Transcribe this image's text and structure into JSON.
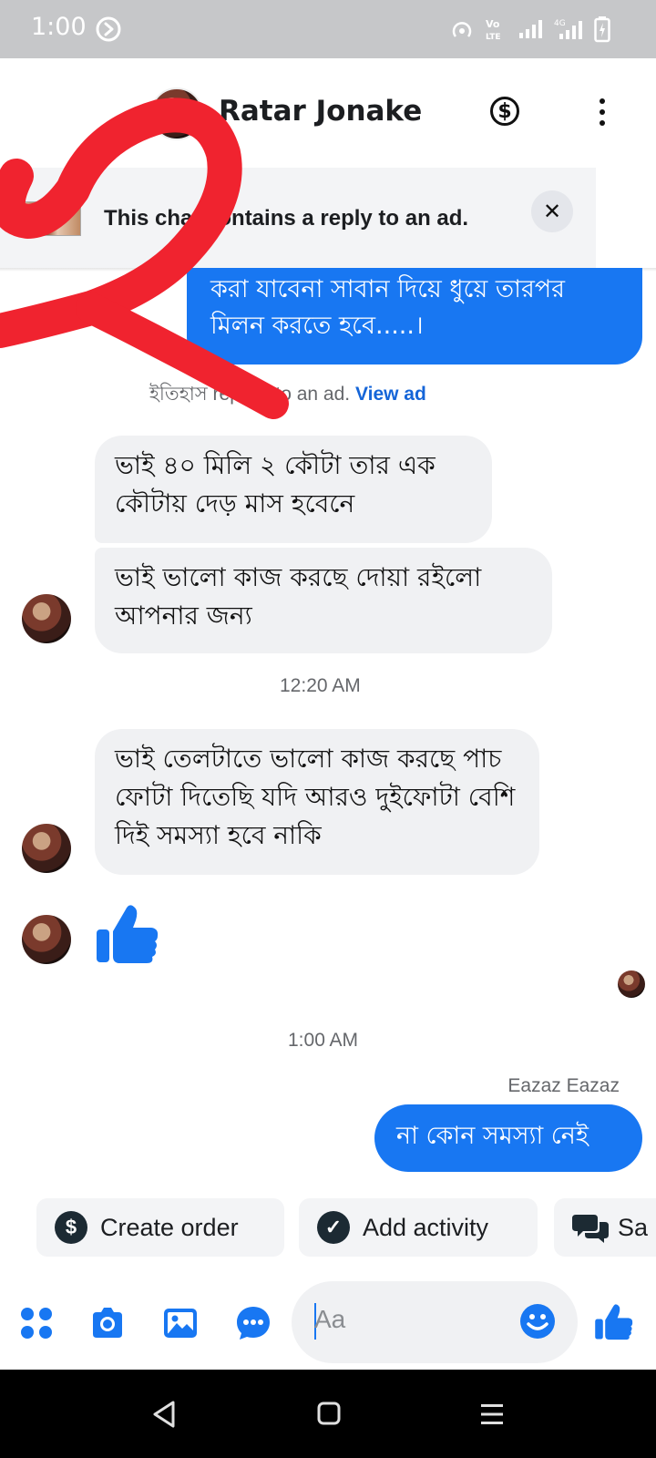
{
  "status_bar": {
    "time": "1:00",
    "icons": [
      "hotspot-icon",
      "volte-icon",
      "signal-icon",
      "signal-4g-icon",
      "battery-charging-icon"
    ]
  },
  "header": {
    "contact_name": "Ratar Jonake",
    "icons": [
      "contact-avatar",
      "payment-dollar-icon",
      "more-options-icon"
    ]
  },
  "ad_banner": {
    "text": "This chat contains a reply to an ad.",
    "close_glyph": "✕"
  },
  "messages": {
    "top_outgoing": "করা যাবেনা সাবান দিয়ে ধুয়ে তারপর মিলন করতে হবে.....।",
    "reply_note_prefix": "ইতিহাস replied to an ad.",
    "reply_note_link": "View ad",
    "incoming_1": "ভাই ৪০ মিলি ২ কৌটা তার এক কৌটায় দেড় মাস হবেনে",
    "incoming_2": "ভাই ভালো কাজ করছে দোয়া রইলো আপনার জন্য",
    "time_1": "12:20 AM",
    "incoming_3": "ভাই তেলটাতে ভালো কাজ করছে পাচ ফোটা দিতেছি যদি আরও দুইফোটা বেশি দিই সমস্যা হবে নাকি",
    "time_2": "1:00 AM",
    "sender_name": "Eazaz Eazaz",
    "outgoing_last": "না কোন সমস্যা নেই"
  },
  "quick_actions": [
    {
      "label": "Create order",
      "icon": "dollar-icon"
    },
    {
      "label": "Add activity",
      "icon": "check-icon"
    },
    {
      "label": "Sa",
      "icon": "chat-bubbles-icon"
    }
  ],
  "composer": {
    "placeholder": "Aa",
    "icons": [
      "apps-grid-icon",
      "camera-icon",
      "gallery-icon",
      "messenger-chat-icon",
      "emoji-icon",
      "thumbs-up-icon"
    ]
  },
  "colors": {
    "accent": "#1877f2",
    "incoming_bubble": "#f0f1f3",
    "status_bar": "#c6c7c9",
    "scribble": "#f0232f"
  }
}
